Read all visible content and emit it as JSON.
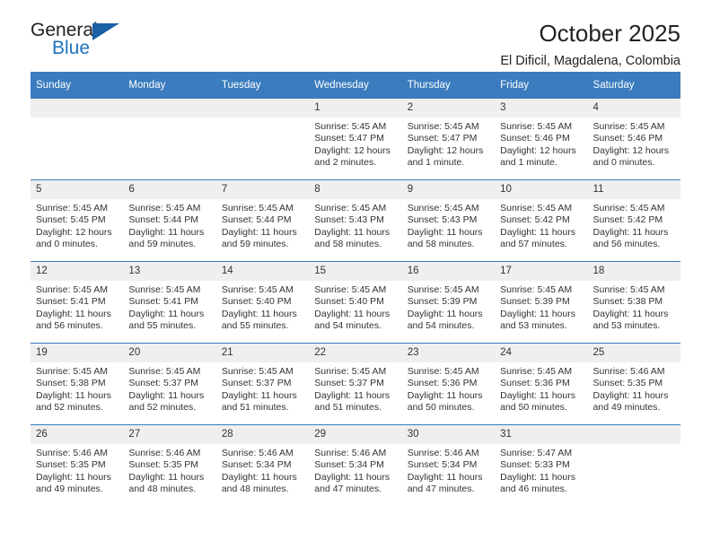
{
  "brand": {
    "name_part1": "General",
    "name_part2": "Blue"
  },
  "header": {
    "title": "October 2025",
    "subtitle": "El Dificil, Magdalena, Colombia"
  },
  "calendar": {
    "weekday_headers": [
      "Sunday",
      "Monday",
      "Tuesday",
      "Wednesday",
      "Thursday",
      "Friday",
      "Saturday"
    ],
    "accent_color": "#3a7cbe",
    "daynum_bg": "#efefef",
    "weeks": [
      [
        {
          "day": "",
          "sunrise": "",
          "sunset": "",
          "daylight": ""
        },
        {
          "day": "",
          "sunrise": "",
          "sunset": "",
          "daylight": ""
        },
        {
          "day": "",
          "sunrise": "",
          "sunset": "",
          "daylight": ""
        },
        {
          "day": "1",
          "sunrise": "Sunrise: 5:45 AM",
          "sunset": "Sunset: 5:47 PM",
          "daylight": "Daylight: 12 hours and 2 minutes."
        },
        {
          "day": "2",
          "sunrise": "Sunrise: 5:45 AM",
          "sunset": "Sunset: 5:47 PM",
          "daylight": "Daylight: 12 hours and 1 minute."
        },
        {
          "day": "3",
          "sunrise": "Sunrise: 5:45 AM",
          "sunset": "Sunset: 5:46 PM",
          "daylight": "Daylight: 12 hours and 1 minute."
        },
        {
          "day": "4",
          "sunrise": "Sunrise: 5:45 AM",
          "sunset": "Sunset: 5:46 PM",
          "daylight": "Daylight: 12 hours and 0 minutes."
        }
      ],
      [
        {
          "day": "5",
          "sunrise": "Sunrise: 5:45 AM",
          "sunset": "Sunset: 5:45 PM",
          "daylight": "Daylight: 12 hours and 0 minutes."
        },
        {
          "day": "6",
          "sunrise": "Sunrise: 5:45 AM",
          "sunset": "Sunset: 5:44 PM",
          "daylight": "Daylight: 11 hours and 59 minutes."
        },
        {
          "day": "7",
          "sunrise": "Sunrise: 5:45 AM",
          "sunset": "Sunset: 5:44 PM",
          "daylight": "Daylight: 11 hours and 59 minutes."
        },
        {
          "day": "8",
          "sunrise": "Sunrise: 5:45 AM",
          "sunset": "Sunset: 5:43 PM",
          "daylight": "Daylight: 11 hours and 58 minutes."
        },
        {
          "day": "9",
          "sunrise": "Sunrise: 5:45 AM",
          "sunset": "Sunset: 5:43 PM",
          "daylight": "Daylight: 11 hours and 58 minutes."
        },
        {
          "day": "10",
          "sunrise": "Sunrise: 5:45 AM",
          "sunset": "Sunset: 5:42 PM",
          "daylight": "Daylight: 11 hours and 57 minutes."
        },
        {
          "day": "11",
          "sunrise": "Sunrise: 5:45 AM",
          "sunset": "Sunset: 5:42 PM",
          "daylight": "Daylight: 11 hours and 56 minutes."
        }
      ],
      [
        {
          "day": "12",
          "sunrise": "Sunrise: 5:45 AM",
          "sunset": "Sunset: 5:41 PM",
          "daylight": "Daylight: 11 hours and 56 minutes."
        },
        {
          "day": "13",
          "sunrise": "Sunrise: 5:45 AM",
          "sunset": "Sunset: 5:41 PM",
          "daylight": "Daylight: 11 hours and 55 minutes."
        },
        {
          "day": "14",
          "sunrise": "Sunrise: 5:45 AM",
          "sunset": "Sunset: 5:40 PM",
          "daylight": "Daylight: 11 hours and 55 minutes."
        },
        {
          "day": "15",
          "sunrise": "Sunrise: 5:45 AM",
          "sunset": "Sunset: 5:40 PM",
          "daylight": "Daylight: 11 hours and 54 minutes."
        },
        {
          "day": "16",
          "sunrise": "Sunrise: 5:45 AM",
          "sunset": "Sunset: 5:39 PM",
          "daylight": "Daylight: 11 hours and 54 minutes."
        },
        {
          "day": "17",
          "sunrise": "Sunrise: 5:45 AM",
          "sunset": "Sunset: 5:39 PM",
          "daylight": "Daylight: 11 hours and 53 minutes."
        },
        {
          "day": "18",
          "sunrise": "Sunrise: 5:45 AM",
          "sunset": "Sunset: 5:38 PM",
          "daylight": "Daylight: 11 hours and 53 minutes."
        }
      ],
      [
        {
          "day": "19",
          "sunrise": "Sunrise: 5:45 AM",
          "sunset": "Sunset: 5:38 PM",
          "daylight": "Daylight: 11 hours and 52 minutes."
        },
        {
          "day": "20",
          "sunrise": "Sunrise: 5:45 AM",
          "sunset": "Sunset: 5:37 PM",
          "daylight": "Daylight: 11 hours and 52 minutes."
        },
        {
          "day": "21",
          "sunrise": "Sunrise: 5:45 AM",
          "sunset": "Sunset: 5:37 PM",
          "daylight": "Daylight: 11 hours and 51 minutes."
        },
        {
          "day": "22",
          "sunrise": "Sunrise: 5:45 AM",
          "sunset": "Sunset: 5:37 PM",
          "daylight": "Daylight: 11 hours and 51 minutes."
        },
        {
          "day": "23",
          "sunrise": "Sunrise: 5:45 AM",
          "sunset": "Sunset: 5:36 PM",
          "daylight": "Daylight: 11 hours and 50 minutes."
        },
        {
          "day": "24",
          "sunrise": "Sunrise: 5:45 AM",
          "sunset": "Sunset: 5:36 PM",
          "daylight": "Daylight: 11 hours and 50 minutes."
        },
        {
          "day": "25",
          "sunrise": "Sunrise: 5:46 AM",
          "sunset": "Sunset: 5:35 PM",
          "daylight": "Daylight: 11 hours and 49 minutes."
        }
      ],
      [
        {
          "day": "26",
          "sunrise": "Sunrise: 5:46 AM",
          "sunset": "Sunset: 5:35 PM",
          "daylight": "Daylight: 11 hours and 49 minutes."
        },
        {
          "day": "27",
          "sunrise": "Sunrise: 5:46 AM",
          "sunset": "Sunset: 5:35 PM",
          "daylight": "Daylight: 11 hours and 48 minutes."
        },
        {
          "day": "28",
          "sunrise": "Sunrise: 5:46 AM",
          "sunset": "Sunset: 5:34 PM",
          "daylight": "Daylight: 11 hours and 48 minutes."
        },
        {
          "day": "29",
          "sunrise": "Sunrise: 5:46 AM",
          "sunset": "Sunset: 5:34 PM",
          "daylight": "Daylight: 11 hours and 47 minutes."
        },
        {
          "day": "30",
          "sunrise": "Sunrise: 5:46 AM",
          "sunset": "Sunset: 5:34 PM",
          "daylight": "Daylight: 11 hours and 47 minutes."
        },
        {
          "day": "31",
          "sunrise": "Sunrise: 5:47 AM",
          "sunset": "Sunset: 5:33 PM",
          "daylight": "Daylight: 11 hours and 46 minutes."
        },
        {
          "day": "",
          "sunrise": "",
          "sunset": "",
          "daylight": ""
        }
      ]
    ]
  }
}
